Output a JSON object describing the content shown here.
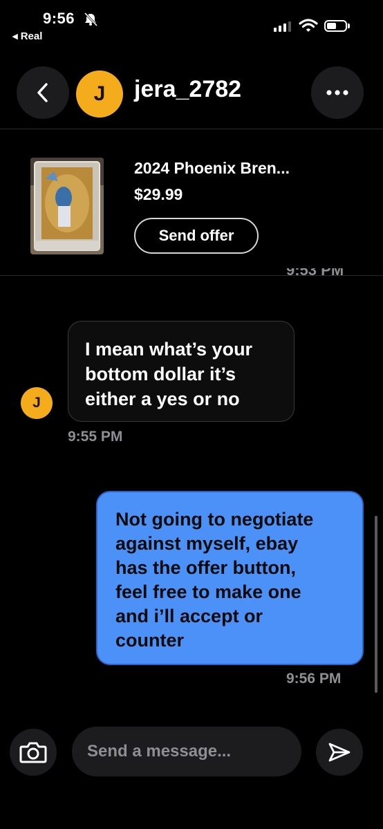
{
  "status_bar": {
    "time": "9:56",
    "back_app": "◂ Real",
    "icons": [
      "bell-slash-icon",
      "signal-icon",
      "wifi-icon",
      "battery-icon"
    ]
  },
  "header": {
    "avatar_letter": "J",
    "username": "jera_2782",
    "icons": [
      "chevron-left-icon",
      "more-horizontal-icon"
    ],
    "avatar_color": "#f5ac1c"
  },
  "listing": {
    "title": "2024 Phoenix Bren...",
    "price": "$29.99",
    "offer_button": "Send offer"
  },
  "conversation": {
    "partial_timestamp": "9:53 PM",
    "messages": [
      {
        "direction": "incoming",
        "avatar_letter": "J",
        "lines": [
          "I mean what’s your",
          "bottom dollar it’s",
          "either a yes or no"
        ],
        "time": "9:55 PM"
      },
      {
        "direction": "outgoing",
        "lines": [
          "Not going to negotiate",
          "against myself, ebay",
          "has the offer button,",
          "feel free to make one",
          "and i’ll accept or",
          "counter"
        ],
        "time": "9:56 PM"
      }
    ],
    "outgoing_bubble_color": "#4c91f7"
  },
  "composer": {
    "placeholder": "Send a message...",
    "icons": [
      "camera-icon",
      "send-icon"
    ]
  }
}
